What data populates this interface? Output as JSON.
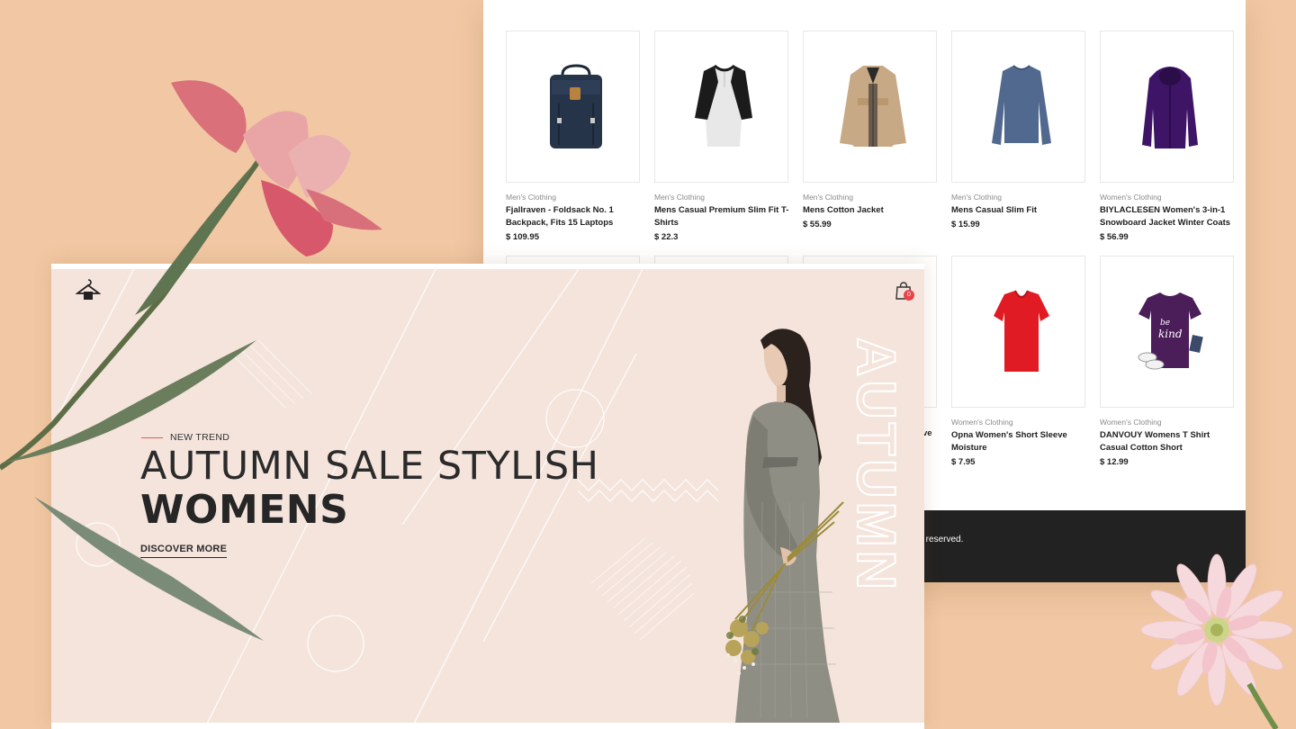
{
  "products": [
    {
      "category": "Men's Clothing",
      "name": "Fjallraven - Foldsack No. 1 Backpack, Fits 15 Laptops",
      "price": "$ 109.95",
      "icon": "backpack-icon"
    },
    {
      "category": "Men's Clothing",
      "name": "Mens Casual Premium Slim Fit T-Shirts",
      "price": "$ 22.3",
      "icon": "raglan-shirt-icon"
    },
    {
      "category": "Men's Clothing",
      "name": "Mens Cotton Jacket",
      "price": "$ 55.99",
      "icon": "jacket-icon"
    },
    {
      "category": "Men's Clothing",
      "name": "Mens Casual Slim Fit",
      "price": "$ 15.99",
      "icon": "longsleeve-shirt-icon"
    },
    {
      "category": "Women's Clothing",
      "name": "BIYLACLESEN Women's 3-in-1 Snowboard Jacket Winter Coats",
      "price": "$ 56.99",
      "icon": "purple-jacket-icon"
    },
    {
      "category": "Women's Clothing",
      "name": "Opna Women's Short Sleeve Moisture",
      "price": "$ 7.95",
      "icon": "red-tshirt-icon"
    },
    {
      "category": "Women's Clothing",
      "name": "DANVOUY Womens T Shirt Casual Cotton Short",
      "price": "$ 12.99",
      "icon": "purple-tshirt-icon"
    }
  ],
  "partial_row": {
    "name_fragment": "ve"
  },
  "footer": {
    "text": "ghts reserved."
  },
  "hero": {
    "cart_count": "0",
    "tagline": "NEW TREND",
    "headline": "AUTUMN SALE STYLISH",
    "headline_bold": "WOMENS",
    "cta": "DISCOVER MORE",
    "vertical_word": "AUTUMN"
  },
  "colors": {
    "background": "#f1c8a3",
    "hero_bg": "#f4e4dc",
    "accent": "#e25b55",
    "footer": "#222222"
  }
}
